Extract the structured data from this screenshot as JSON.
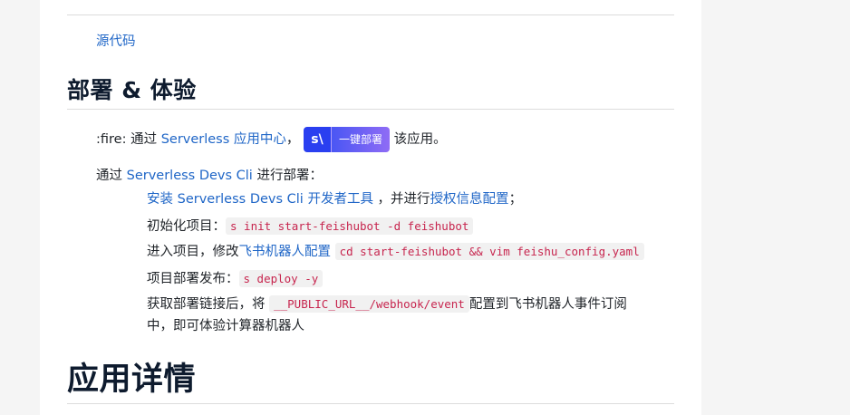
{
  "source_link": "源代码",
  "deploy_heading": "部署 & 体验",
  "fire_line": {
    "prefix": ":fire: 通过 ",
    "link": "Serverless 应用中心",
    "comma": "，",
    "badge_logo": "s\\",
    "badge_label": "一键部署",
    "suffix": " 该应用。"
  },
  "devs_line": {
    "prefix": "通过 ",
    "link": "Serverless Devs Cli",
    "suffix": " 进行部署："
  },
  "steps": {
    "install": {
      "link": "安装 Serverless Devs Cli 开发者工具",
      "mid": " ，并进行",
      "link2": "授权信息配置",
      "end": "；"
    },
    "init": {
      "label": "初始化项目：",
      "code": "s init start-feishubot -d feishubot"
    },
    "enter": {
      "label": "进入项目，修改",
      "link": "飞书机器人配置",
      "code": "cd start-feishubot && vim feishu_config.yaml"
    },
    "publish": {
      "label": "项目部署发布：",
      "code": "s deploy -y"
    },
    "url": {
      "label": "获取部署链接后，将 ",
      "code": "__PUBLIC_URL__/webhook/event",
      "label2": "配置到飞书机器人事件订阅",
      "line2": "中，即可体验计算器机器人"
    }
  },
  "details_heading": "应用详情",
  "colors": {
    "link": "#1f66c7",
    "code_text": "#c7254e",
    "code_bg": "#f1f1f1",
    "badge_logo_bg": "#2a3ff0",
    "heading": "#0e1b2e"
  }
}
